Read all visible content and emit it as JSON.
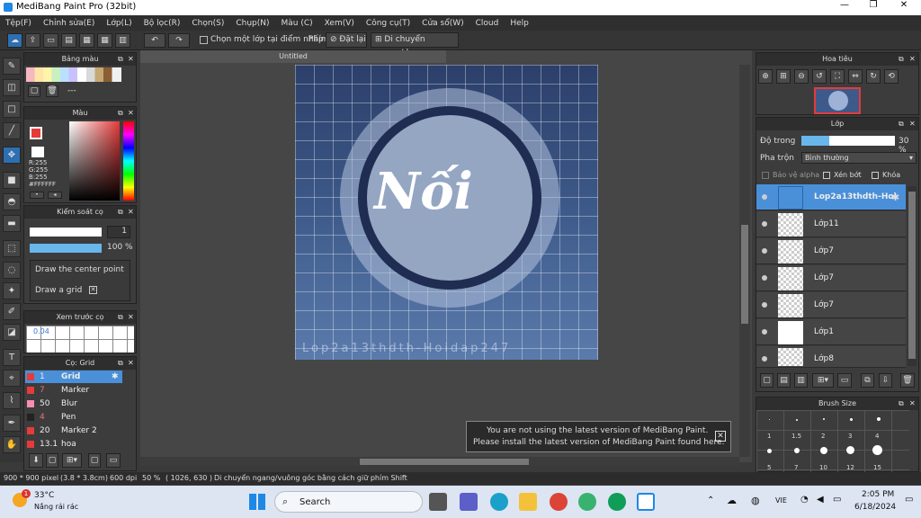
{
  "window": {
    "title": "MediBang Paint Pro (32bit)"
  },
  "menu": [
    "Tệp(F)",
    "Chỉnh sửa(E)",
    "Lớp(L)",
    "Bộ lọc(R)",
    "Chọn(S)",
    "Chụp(N)",
    "Màu (C)",
    "Xem(V)",
    "Công cụ(T)",
    "Cửa sổ(W)",
    "Cloud",
    "Help"
  ],
  "toolbar": {
    "select_one_layer": "Chọn một lớp tại điểm nhấp",
    "shortcut_label": "Phím",
    "reset_label": "Đặt lại",
    "move_label": "Di chuyển ngang/dọc"
  },
  "palette": {
    "title": "Bảng màu",
    "dash": "---"
  },
  "color": {
    "title": "Màu",
    "r": "R:255",
    "g": "G:255",
    "b": "B:255",
    "hex": "#FFFFFF",
    "primary": "#e53b3b"
  },
  "brushctl": {
    "title": "Kiểm soát cọ",
    "size_value": "1",
    "opacity_value": "100 %",
    "opt1": "Draw the center point",
    "opt2": "Draw a grid"
  },
  "preview": {
    "title": "Xem trước cọ",
    "value": "0.04"
  },
  "brushlist": {
    "title": "Cọ: Grid",
    "items": [
      {
        "size": "1",
        "name": "Grid"
      },
      {
        "size": "7",
        "name": "Marker"
      },
      {
        "size": "50",
        "name": "Blur"
      },
      {
        "size": "4",
        "name": "Pen"
      },
      {
        "size": "20",
        "name": "Marker 2"
      },
      {
        "size": "13.1",
        "name": "hoa"
      }
    ]
  },
  "canvas": {
    "tab": "Untitled",
    "watermark": "Lop2a13thdth-Hoidap247",
    "art_text": "Nối"
  },
  "navigator": {
    "title": "Hoa tiêu"
  },
  "layers": {
    "title": "Lớp",
    "opacity_label": "Độ trong",
    "opacity_value": "30 %",
    "blend_label": "Pha trộn",
    "blend_value": "Bình thường",
    "alpha_label": "Bảo vệ alpha",
    "clip_label": "Xén bớt",
    "lock_label": "Khóa",
    "items": [
      "Lop2a13thdth-Hoi",
      "Lớp11",
      "Lớp7",
      "Lớp7",
      "Lớp7",
      "Lớp1",
      "Lớp8"
    ]
  },
  "brushsize": {
    "title": "Brush Size",
    "sizes": [
      "1",
      "1.5",
      "2",
      "3",
      "4",
      "5",
      "7",
      "10",
      "12",
      "15"
    ]
  },
  "notice": {
    "line1": "You are not using the latest version of MediBang Paint.",
    "line2": "Please install the latest version of MediBang Paint found here."
  },
  "status": {
    "size": "900 * 900 pixel",
    "cm": "(3.8 * 3.8cm)",
    "dpi": "600 dpi",
    "zoom": "50 %",
    "coords": "( 1026, 630 )",
    "hint": "Di chuyển ngang/vuông góc bằng cách giữ phím Shift"
  },
  "taskbar": {
    "temp": "33°C",
    "weather": "Nắng rải rác",
    "badge": "1",
    "search": "Search",
    "lang": "VIE",
    "time": "2:05 PM",
    "date": "6/18/2024"
  }
}
